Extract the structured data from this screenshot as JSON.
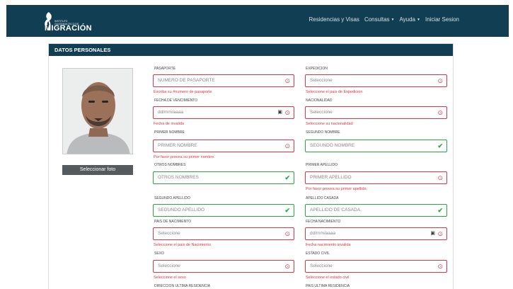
{
  "navbar": {
    "logo_small": "INSTITUTO GUATEMALTECO DE",
    "logo_big": "MIGRACIÓN",
    "links": [
      "Residencias y Visas",
      "Consultas",
      "Ayuda",
      "Iniciar Sesion"
    ]
  },
  "card": {
    "title": "DATOS PERSONALES",
    "photo_button": "Seleccionar foto"
  },
  "form": {
    "pasaporte": {
      "label": "PASAPORTE",
      "placeholder": "NUMERO DE PASAPORTE",
      "feedback": "Escriba su #numero de pasaporte"
    },
    "expedicion": {
      "label": "EXPEDICION",
      "value": "Seleccione",
      "feedback": "Seleccione el pais de Expedicion"
    },
    "fecha_vencimiento": {
      "label": "FECHA DE VENCIMIENTO",
      "placeholder": "dd/mm/aaaa",
      "feedback": "Fecha de invalida"
    },
    "nacionalidad": {
      "label": "NACIONALIDAD",
      "value": "Seleccione",
      "feedback": "Seleccione su nacionalidad"
    },
    "primer_nombre": {
      "label": "PRIMER NOMBRE",
      "placeholder": "PRIMER NOMBRE",
      "feedback": "Por favor provea su primer nombre."
    },
    "segundo_nombre": {
      "label": "SEGUNDO NOMBRE",
      "placeholder": "SEGUNDO NOMBRE"
    },
    "otros_nombres": {
      "label": "OTROS NOMBRES",
      "placeholder": "OTROS NOMBRES"
    },
    "primer_apellido": {
      "label": "PRIMER APELLIDO",
      "placeholder": "PRIMER APELLIDO",
      "feedback": "Por favor provea su primer apellido."
    },
    "segundo_apellido": {
      "label": "SEGUNDO APELLIDO",
      "placeholder": "SEGUNDO APELLIDO"
    },
    "apellido_casada": {
      "label": "APELLIDO CASADA",
      "placeholder": "APELLIDO DE CASADA"
    },
    "pais_nacimiento": {
      "label": "PAIS DE NACIMIENTO",
      "value": "Seleccione",
      "feedback": "Seleccione el pais de Nacimiento"
    },
    "fecha_nacimiento": {
      "label": "FECHA NACIMIENTO",
      "placeholder": "dd/mm/aaaa",
      "feedback": "Fecha nacimiento invalida"
    },
    "sexo": {
      "label": "SEXO",
      "value": "Seleccione",
      "feedback": "Seleccione el sexo"
    },
    "estado_civil": {
      "label": "ESTADO CIVIL",
      "value": "Seleccione",
      "feedback": "Seleccione el estado civil"
    },
    "direccion_ultima_residencia": {
      "label": "DIRECCION ULTIMA RESIDENCIA"
    },
    "pais_ultima_residencia": {
      "label": "PAIS ULTIMA RESIDENCIA"
    }
  },
  "colors": {
    "navbar": "#123e54",
    "invalid": "#dc3545",
    "valid": "#28a745"
  }
}
